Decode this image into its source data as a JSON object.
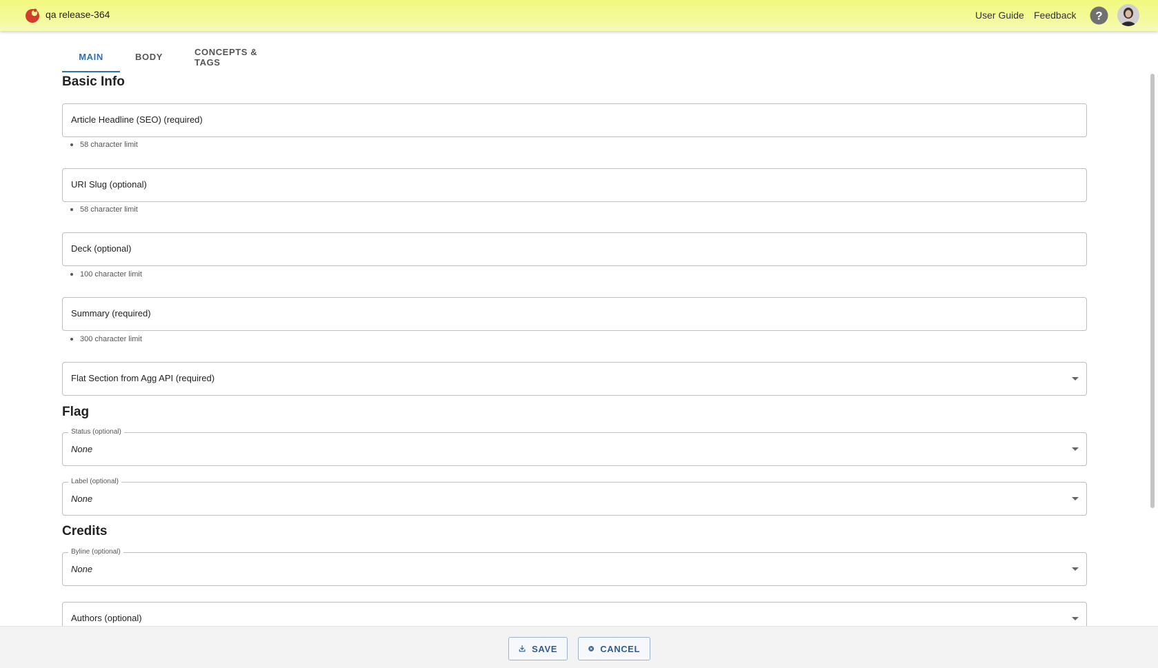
{
  "header": {
    "app_title": "qa release-364",
    "links": {
      "user_guide": "User Guide",
      "feedback": "Feedback"
    },
    "brand_color": "#d33d2d",
    "icons": [
      "logo-icon",
      "help-icon",
      "avatar"
    ]
  },
  "tabs": [
    {
      "label": "MAIN",
      "active": true
    },
    {
      "label": "BODY",
      "active": false
    },
    {
      "label": "CONCEPTS & TAGS",
      "active": false
    }
  ],
  "basic_info": {
    "title": "Basic Info",
    "headline": {
      "label": "Article Headline (SEO) (required)",
      "hint": "58 character limit"
    },
    "uri_slug": {
      "label": "URI Slug (optional)",
      "hint": "58 character limit"
    },
    "deck": {
      "label": "Deck (optional)",
      "hint": "100 character limit"
    },
    "summary": {
      "label": "Summary (required)",
      "hint": "300 character limit"
    },
    "section": {
      "label": "Flat Section from Agg API (required)"
    }
  },
  "flag": {
    "title": "Flag",
    "status": {
      "label": "Status (optional)",
      "value": "None"
    },
    "label": {
      "label": "Label (optional)",
      "value": "None"
    }
  },
  "credits": {
    "title": "Credits",
    "byline": {
      "label": "Byline (optional)",
      "value": "None"
    },
    "authors": {
      "label": "Authors (optional)"
    }
  },
  "footer": {
    "save_label": "SAVE",
    "cancel_label": "CANCEL",
    "accent_color": "#2d5d96"
  }
}
